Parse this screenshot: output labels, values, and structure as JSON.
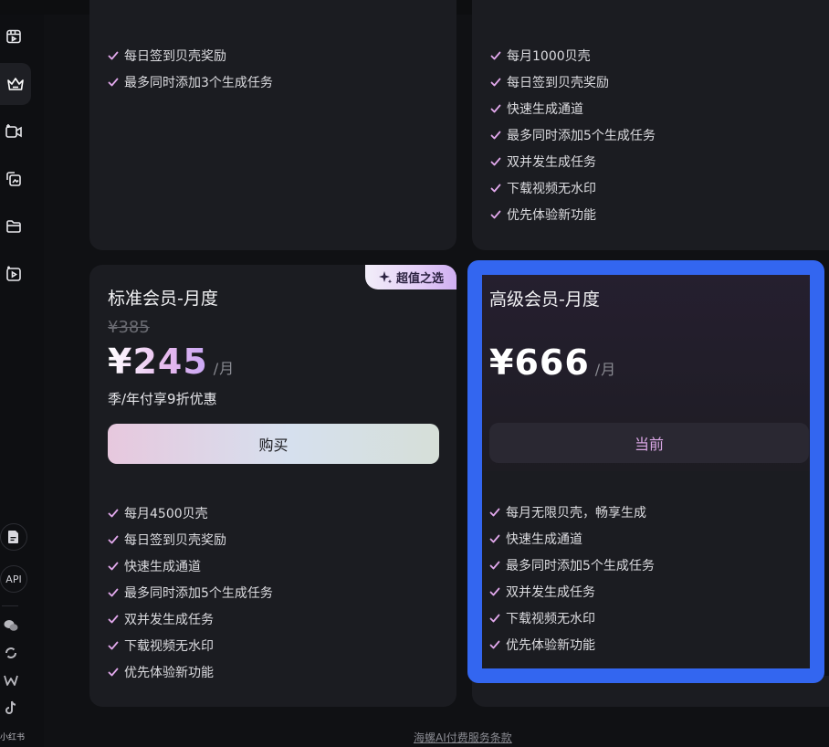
{
  "sidebar": {
    "api_label": "API",
    "xiaohongshu_label": "小红书"
  },
  "top_left_card": {
    "features": [
      "每日签到贝壳奖励",
      "最多同时添加3个生成任务"
    ]
  },
  "top_right_card": {
    "features": [
      "每月1000贝壳",
      "每日签到贝壳奖励",
      "快速生成通道",
      "最多同时添加5个生成任务",
      "双并发生成任务",
      "下载视频无水印",
      "优先体验新功能"
    ]
  },
  "standard_plan": {
    "badge": "超值之选",
    "name": "标准会员-月度",
    "original_price": "¥385",
    "price": "¥245",
    "unit": "/月",
    "discount_note": "季/年付享9折优惠",
    "buy_label": "购买",
    "features": [
      "每月4500贝壳",
      "每日签到贝壳奖励",
      "快速生成通道",
      "最多同时添加5个生成任务",
      "双并发生成任务",
      "下载视频无水印",
      "优先体验新功能"
    ]
  },
  "premium_plan": {
    "name": "高级会员-月度",
    "price": "¥666",
    "unit": "/月",
    "current_label": "当前",
    "features": [
      "每月无限贝壳，畅享生成",
      "快速生成通道",
      "最多同时添加5个生成任务",
      "双并发生成任务",
      "下载视频无水印",
      "优先体验新功能"
    ]
  },
  "footer": {
    "terms_link": "海螺AI付费服务条款"
  },
  "colors": {
    "highlight_border": "#3366f0",
    "check": "#e2a8ec",
    "card_bg": "#1b1c21",
    "page_bg": "#101114"
  }
}
